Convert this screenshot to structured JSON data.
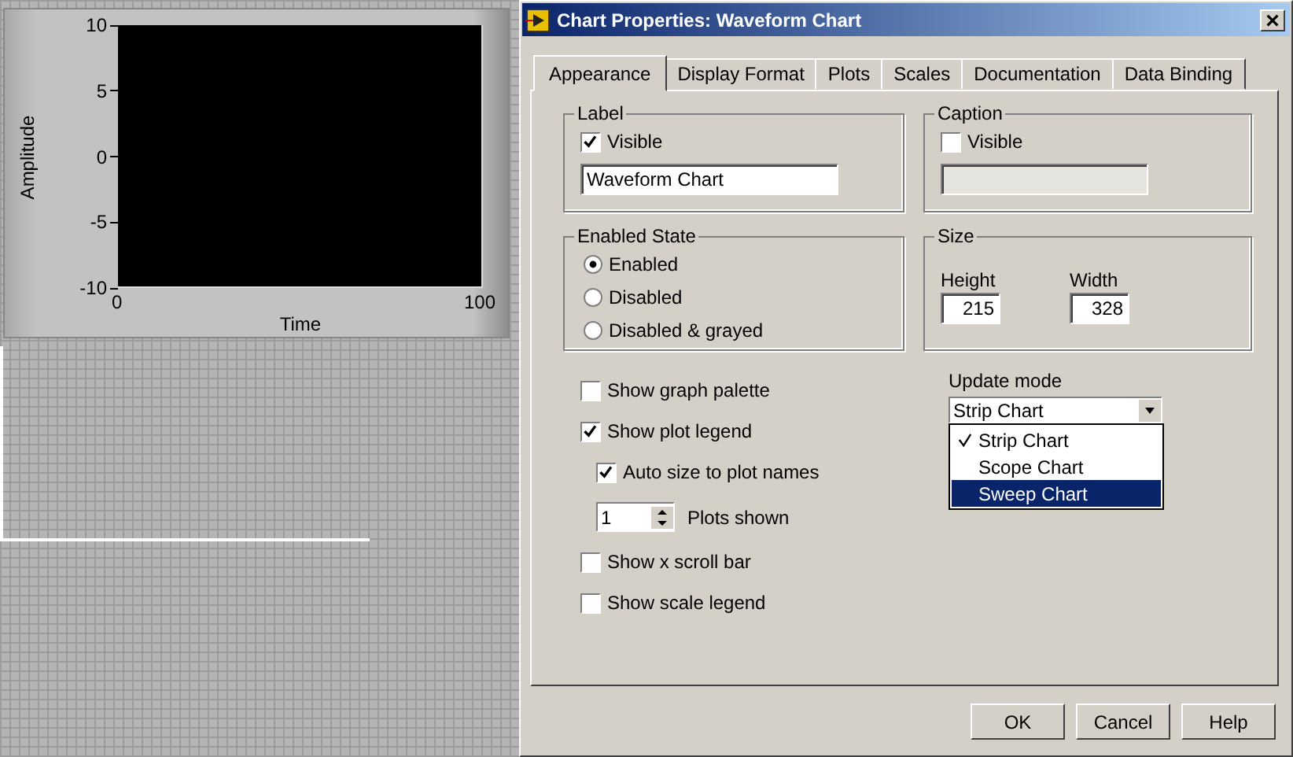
{
  "chart_panel": {
    "y_axis_label": "Amplitude",
    "x_axis_label": "Time",
    "y_ticks": [
      "10",
      "5",
      "0",
      "-5",
      "-10"
    ],
    "x_ticks": [
      "0",
      "100"
    ]
  },
  "window": {
    "title": "Chart Properties: Waveform Chart"
  },
  "tabs": [
    {
      "label": "Appearance",
      "selected": true
    },
    {
      "label": "Display Format",
      "selected": false
    },
    {
      "label": "Plots",
      "selected": false
    },
    {
      "label": "Scales",
      "selected": false
    },
    {
      "label": "Documentation",
      "selected": false
    },
    {
      "label": "Data Binding",
      "selected": false
    }
  ],
  "label_group": {
    "title": "Label",
    "checkbox_label": "Visible",
    "checked": true,
    "value": "Waveform Chart"
  },
  "caption_group": {
    "title": "Caption",
    "checkbox_label": "Visible",
    "checked": false,
    "disabled": true
  },
  "enabled_state": {
    "title": "Enabled State",
    "options": [
      {
        "label": "Enabled",
        "selected": true
      },
      {
        "label": "Disabled",
        "selected": false
      },
      {
        "label": "Disabled & grayed",
        "selected": false
      }
    ]
  },
  "size_group": {
    "title": "Size",
    "height_label": "Height",
    "height_value": "215",
    "width_label": "Width",
    "width_value": "328"
  },
  "options": [
    {
      "kind": "checkbox",
      "label": "Show graph palette",
      "checked": false
    },
    {
      "kind": "checkbox",
      "label": "Show plot legend",
      "checked": true,
      "children": [
        {
          "kind": "checkbox",
          "label": "Auto size to plot names",
          "checked": true
        },
        {
          "kind": "spinner",
          "label": "Plots shown",
          "number": "1"
        }
      ]
    },
    {
      "kind": "checkbox",
      "label": "Show x scroll bar",
      "checked": false
    },
    {
      "kind": "checkbox",
      "label": "Show scale legend",
      "checked": false
    }
  ],
  "update_mode": {
    "label": "Update mode",
    "value": "Strip Chart",
    "expanded": true,
    "menu": [
      {
        "label": "Strip Chart",
        "selected": true,
        "highlighted": false
      },
      {
        "label": "Scope Chart",
        "selected": false,
        "highlighted": false
      },
      {
        "label": "Sweep Chart",
        "selected": false,
        "highlighted": true
      }
    ]
  },
  "buttons": [
    "OK",
    "Cancel",
    "Help"
  ]
}
